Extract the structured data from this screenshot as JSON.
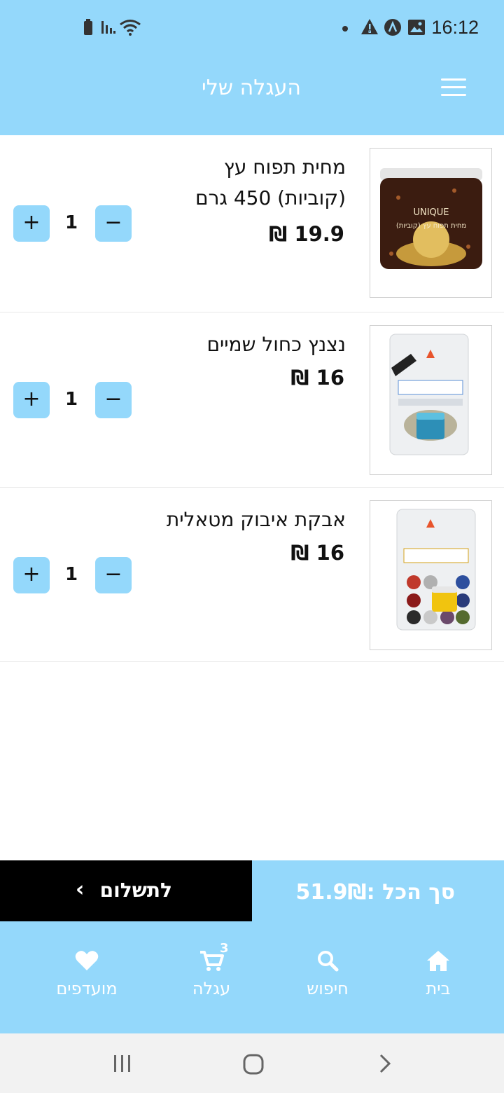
{
  "status_bar": {
    "time": "16:12"
  },
  "header": {
    "title": "העגלה שלי"
  },
  "cart": {
    "items": [
      {
        "name_line1": "מחית תפוח עץ",
        "name_line2": "(קוביות) 450 גרם",
        "price": "19.9 ₪",
        "quantity": "1",
        "image_label": "מחית תפוח עץ (קוביות)",
        "image_brand": "UNIQUE"
      },
      {
        "name_line1": "נצנץ כחול שמיים",
        "price": "16 ₪",
        "quantity": "1"
      },
      {
        "name_line1": "אבקת איבוק מטאלית",
        "price": "16 ₪",
        "quantity": "1"
      }
    ]
  },
  "checkout": {
    "pay_label": "לתשלום",
    "total_label": "סך הכל :51.9₪"
  },
  "bottom_nav": {
    "home": "בית",
    "search": "חיפוש",
    "cart": "עגלה",
    "cart_badge": "3",
    "favorites": "מועדפים"
  },
  "colors": {
    "accent": "#94d8fb",
    "dark": "#000000"
  }
}
